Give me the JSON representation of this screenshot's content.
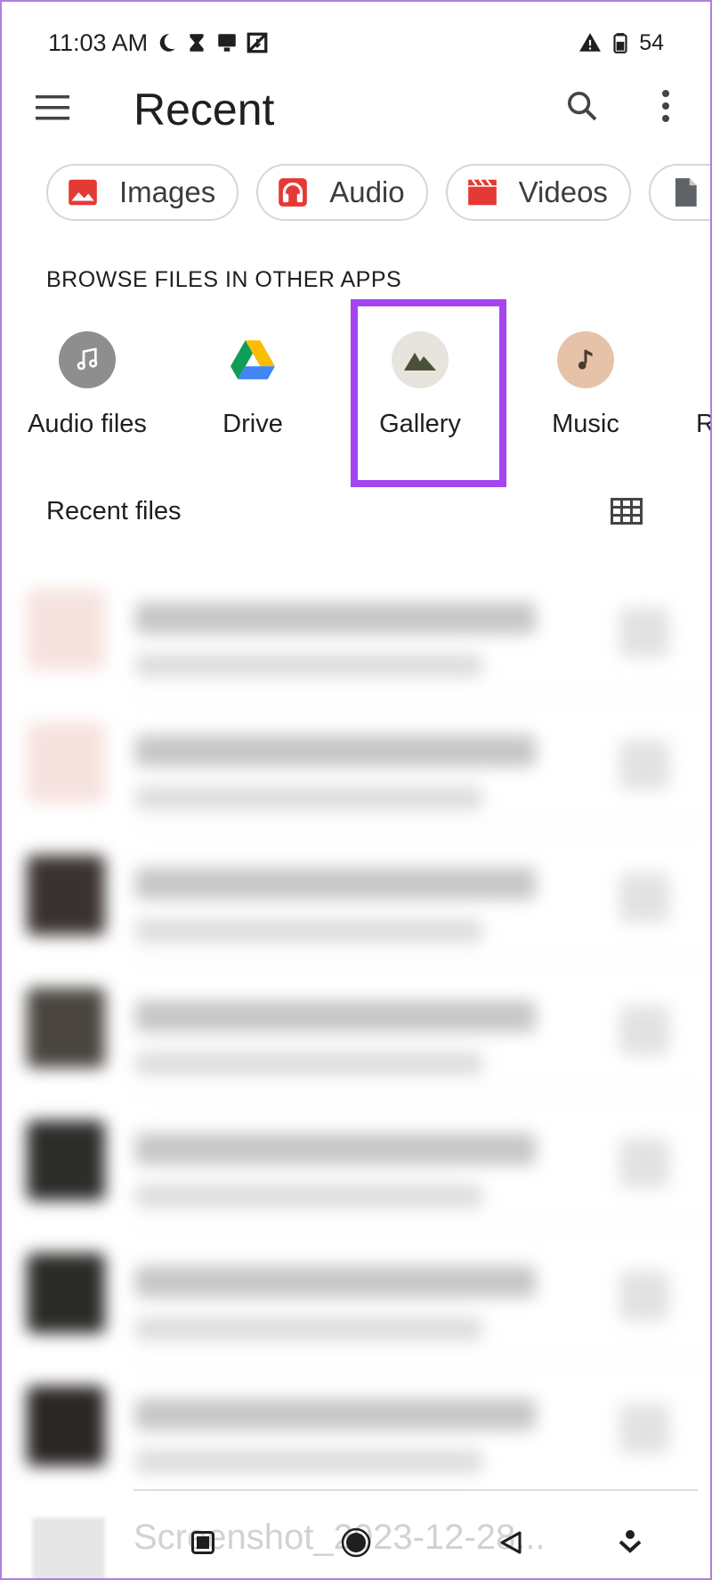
{
  "status_bar": {
    "time": "11:03 AM",
    "battery": "54",
    "icons": [
      "moon-icon",
      "hourglass-icon",
      "cast-icon",
      "data-saver-icon",
      "alert-icon",
      "battery-icon"
    ]
  },
  "app_bar": {
    "title": "Recent"
  },
  "chips": [
    {
      "label": "Images",
      "icon": "image-icon",
      "color": "#e53935"
    },
    {
      "label": "Audio",
      "icon": "headphones-icon",
      "color": "#e53935"
    },
    {
      "label": "Videos",
      "icon": "clapperboard-icon",
      "color": "#e53935"
    }
  ],
  "browse": {
    "title": "BROWSE FILES IN OTHER APPS",
    "apps": [
      {
        "label": "Audio files",
        "icon": "music-note-icon"
      },
      {
        "label": "Drive",
        "icon": "drive-icon"
      },
      {
        "label": "Gallery",
        "icon": "mountain-icon"
      },
      {
        "label": "Music",
        "icon": "music-note-icon"
      },
      {
        "label": "R",
        "icon": ""
      }
    ]
  },
  "recent": {
    "title": "Recent files",
    "partial_file_name": "Screenshot_2023-12-28..."
  },
  "colors": {
    "accent": "#a445ef",
    "chip_icon": "#e53935",
    "gallery_circle": "#e6e4dc",
    "gallery_icon": "#4a4f37",
    "music_circle": "#e6c3a8",
    "music_icon": "#4a3a2c",
    "audio_circle": "#8e8e8e"
  }
}
